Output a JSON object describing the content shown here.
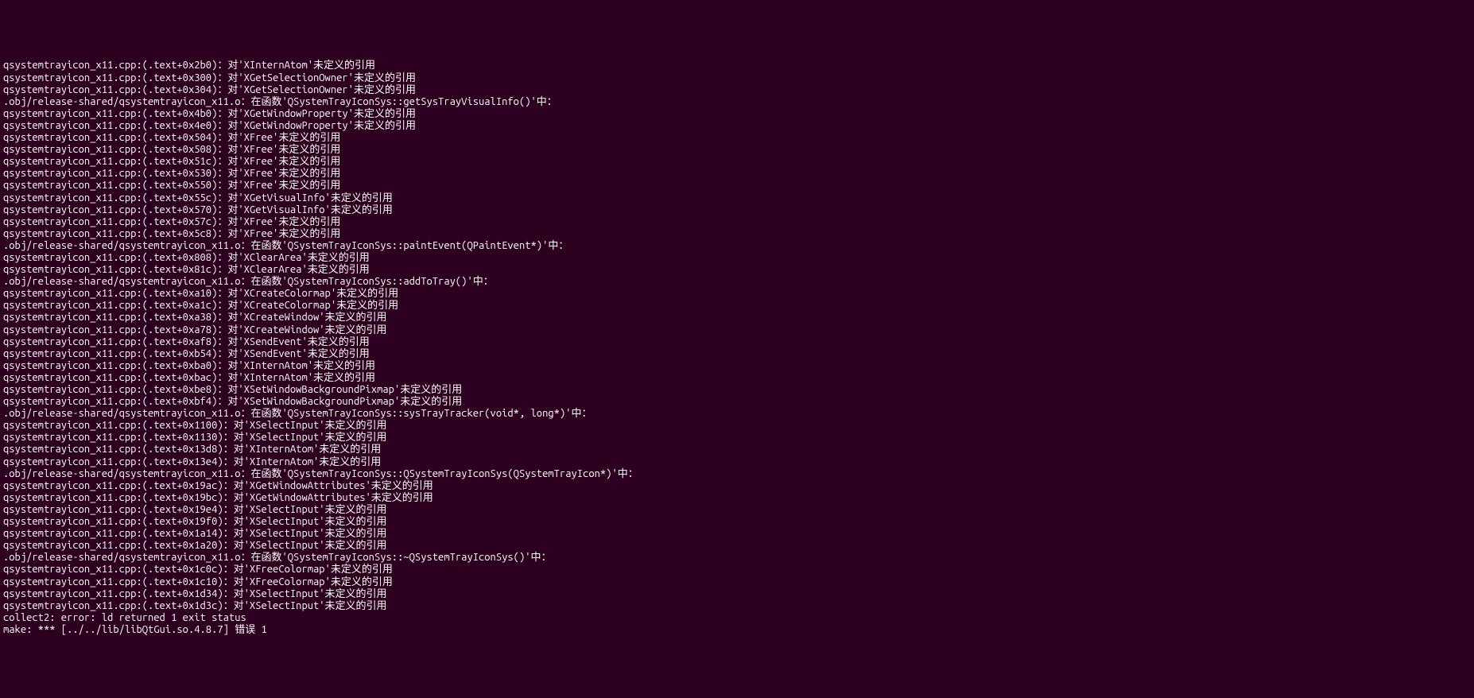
{
  "terminal": {
    "lines": [
      "qsystemtrayicon_x11.cpp:(.text+0x2b0)：对'XInternAtom'未定义的引用",
      "qsystemtrayicon_x11.cpp:(.text+0x300)：对'XGetSelectionOwner'未定义的引用",
      "qsystemtrayicon_x11.cpp:(.text+0x304)：对'XGetSelectionOwner'未定义的引用",
      ".obj/release-shared/qsystemtrayicon_x11.o：在函数'QSystemTrayIconSys::getSysTrayVisualInfo()'中：",
      "qsystemtrayicon_x11.cpp:(.text+0x4b0)：对'XGetWindowProperty'未定义的引用",
      "qsystemtrayicon_x11.cpp:(.text+0x4e0)：对'XGetWindowProperty'未定义的引用",
      "qsystemtrayicon_x11.cpp:(.text+0x504)：对'XFree'未定义的引用",
      "qsystemtrayicon_x11.cpp:(.text+0x508)：对'XFree'未定义的引用",
      "qsystemtrayicon_x11.cpp:(.text+0x51c)：对'XFree'未定义的引用",
      "qsystemtrayicon_x11.cpp:(.text+0x530)：对'XFree'未定义的引用",
      "qsystemtrayicon_x11.cpp:(.text+0x550)：对'XFree'未定义的引用",
      "qsystemtrayicon_x11.cpp:(.text+0x55c)：对'XGetVisualInfo'未定义的引用",
      "qsystemtrayicon_x11.cpp:(.text+0x570)：对'XGetVisualInfo'未定义的引用",
      "qsystemtrayicon_x11.cpp:(.text+0x57c)：对'XFree'未定义的引用",
      "qsystemtrayicon_x11.cpp:(.text+0x5c8)：对'XFree'未定义的引用",
      ".obj/release-shared/qsystemtrayicon_x11.o：在函数'QSystemTrayIconSys::paintEvent(QPaintEvent*)'中：",
      "qsystemtrayicon_x11.cpp:(.text+0x808)：对'XClearArea'未定义的引用",
      "qsystemtrayicon_x11.cpp:(.text+0x81c)：对'XClearArea'未定义的引用",
      ".obj/release-shared/qsystemtrayicon_x11.o：在函数'QSystemTrayIconSys::addToTray()'中：",
      "qsystemtrayicon_x11.cpp:(.text+0xa10)：对'XCreateColormap'未定义的引用",
      "qsystemtrayicon_x11.cpp:(.text+0xa1c)：对'XCreateColormap'未定义的引用",
      "qsystemtrayicon_x11.cpp:(.text+0xa38)：对'XCreateWindow'未定义的引用",
      "qsystemtrayicon_x11.cpp:(.text+0xa78)：对'XCreateWindow'未定义的引用",
      "qsystemtrayicon_x11.cpp:(.text+0xaf8)：对'XSendEvent'未定义的引用",
      "qsystemtrayicon_x11.cpp:(.text+0xb54)：对'XSendEvent'未定义的引用",
      "qsystemtrayicon_x11.cpp:(.text+0xba0)：对'XInternAtom'未定义的引用",
      "qsystemtrayicon_x11.cpp:(.text+0xbac)：对'XInternAtom'未定义的引用",
      "qsystemtrayicon_x11.cpp:(.text+0xbe8)：对'XSetWindowBackgroundPixmap'未定义的引用",
      "qsystemtrayicon_x11.cpp:(.text+0xbf4)：对'XSetWindowBackgroundPixmap'未定义的引用",
      ".obj/release-shared/qsystemtrayicon_x11.o：在函数'QSystemTrayIconSys::sysTrayTracker(void*, long*)'中：",
      "qsystemtrayicon_x11.cpp:(.text+0x1100)：对'XSelectInput'未定义的引用",
      "qsystemtrayicon_x11.cpp:(.text+0x1130)：对'XSelectInput'未定义的引用",
      "qsystemtrayicon_x11.cpp:(.text+0x13d8)：对'XInternAtom'未定义的引用",
      "qsystemtrayicon_x11.cpp:(.text+0x13e4)：对'XInternAtom'未定义的引用",
      ".obj/release-shared/qsystemtrayicon_x11.o：在函数'QSystemTrayIconSys::QSystemTrayIconSys(QSystemTrayIcon*)'中：",
      "qsystemtrayicon_x11.cpp:(.text+0x19ac)：对'XGetWindowAttributes'未定义的引用",
      "qsystemtrayicon_x11.cpp:(.text+0x19bc)：对'XGetWindowAttributes'未定义的引用",
      "qsystemtrayicon_x11.cpp:(.text+0x19e4)：对'XSelectInput'未定义的引用",
      "qsystemtrayicon_x11.cpp:(.text+0x19f0)：对'XSelectInput'未定义的引用",
      "qsystemtrayicon_x11.cpp:(.text+0x1a14)：对'XSelectInput'未定义的引用",
      "qsystemtrayicon_x11.cpp:(.text+0x1a20)：对'XSelectInput'未定义的引用",
      ".obj/release-shared/qsystemtrayicon_x11.o：在函数'QSystemTrayIconSys::~QSystemTrayIconSys()'中：",
      "qsystemtrayicon_x11.cpp:(.text+0x1c0c)：对'XFreeColormap'未定义的引用",
      "qsystemtrayicon_x11.cpp:(.text+0x1c10)：对'XFreeColormap'未定义的引用",
      "qsystemtrayicon_x11.cpp:(.text+0x1d34)：对'XSelectInput'未定义的引用",
      "qsystemtrayicon_x11.cpp:(.text+0x1d3c)：对'XSelectInput'未定义的引用",
      "collect2: error: ld returned 1 exit status",
      "make: *** [../../lib/libQtGui.so.4.8.7] 错误 1"
    ]
  }
}
